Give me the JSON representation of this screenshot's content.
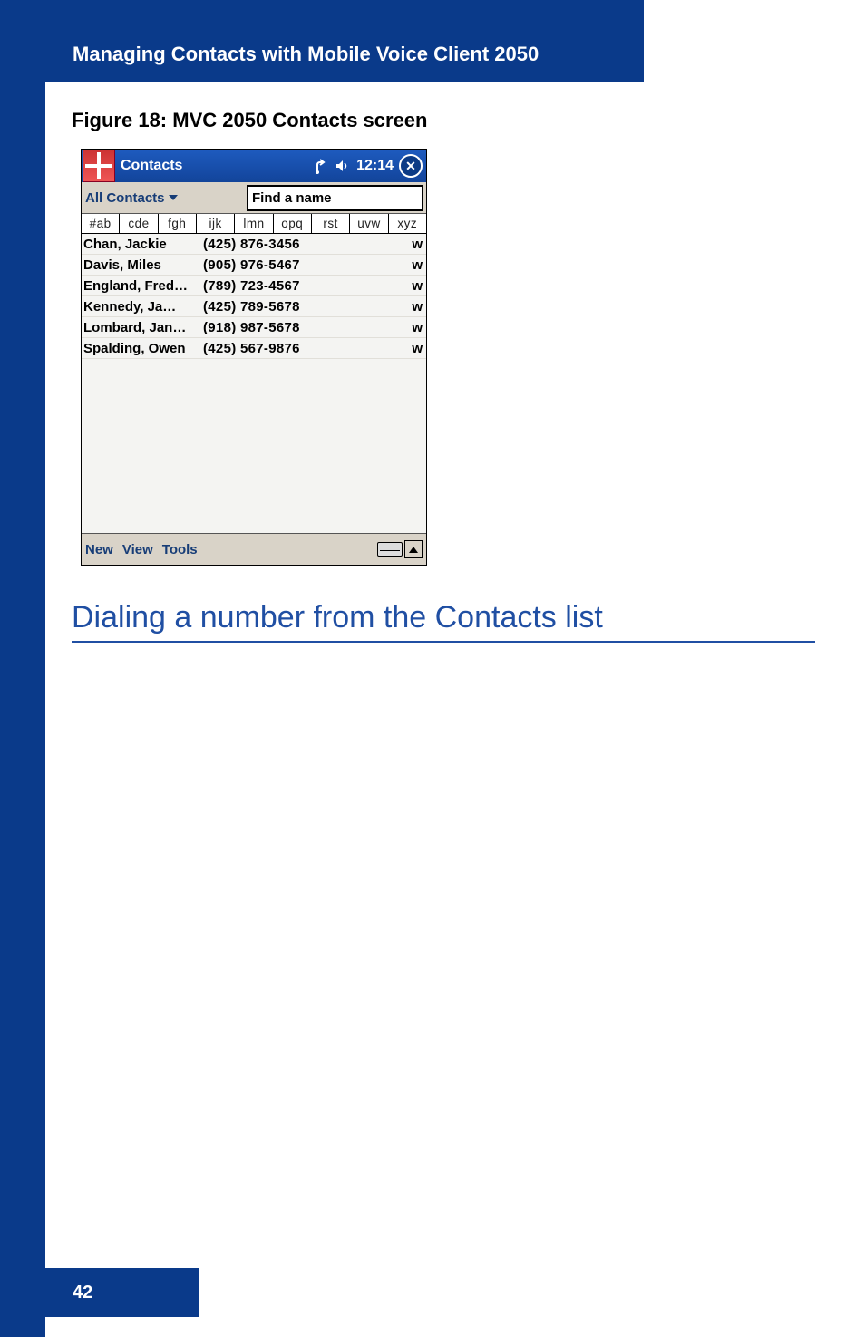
{
  "header": {
    "section_title": "Managing Contacts with Mobile Voice Client 2050"
  },
  "figure": {
    "caption_prefix": "Figure 18:  ",
    "caption_title": "MVC 2050 Contacts screen"
  },
  "screenshot": {
    "title": "Contacts",
    "clock": "12:14",
    "category_dropdown": "All Contacts",
    "search_placeholder": "Find a name",
    "alpha_tabs": [
      "#ab",
      "cde",
      "fgh",
      "ijk",
      "lmn",
      "opq",
      "rst",
      "uvw",
      "xyz"
    ],
    "contacts": [
      {
        "name": "Chan, Jackie",
        "phone": "(425) 876-3456",
        "type": "w"
      },
      {
        "name": "Davis, Miles",
        "phone": "(905) 976-5467",
        "type": "w"
      },
      {
        "name": "England, Fred…",
        "phone": "(789) 723-4567",
        "type": "w"
      },
      {
        "name": "Kennedy, Ja…",
        "phone": "(425) 789-5678",
        "type": "w"
      },
      {
        "name": "Lombard, Jan…",
        "phone": "(918) 987-5678",
        "type": "w"
      },
      {
        "name": "Spalding, Owen",
        "phone": "(425) 567-9876",
        "type": "w"
      }
    ],
    "bottom_menu": [
      "New",
      "View",
      "Tools"
    ]
  },
  "section_heading": "Dialing a number from the Contacts list",
  "page_number": "42"
}
